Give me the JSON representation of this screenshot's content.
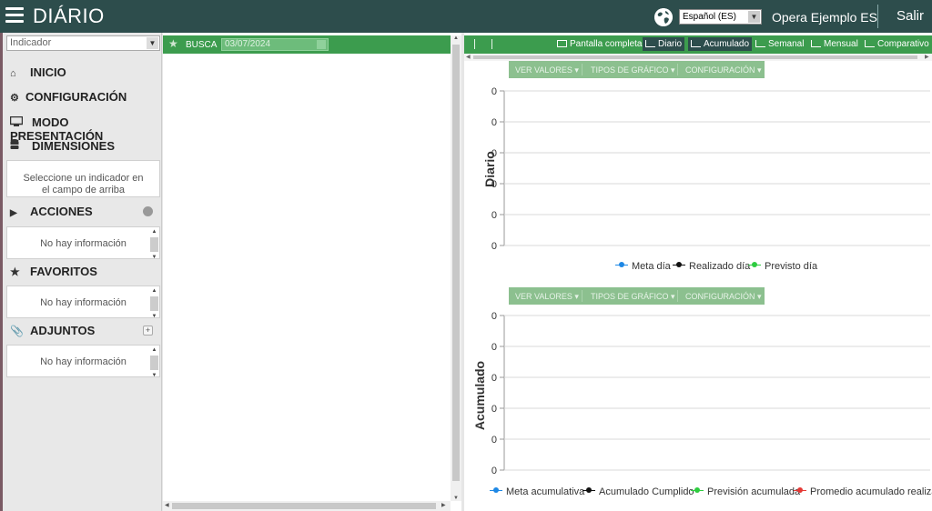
{
  "header": {
    "app_title": "DIÁRIO",
    "language": "Español (ES)",
    "user_name": "Opera Ejemplo ES",
    "logout_label": "Salir"
  },
  "sidebar": {
    "indicator_placeholder": "Indicador",
    "menu": [
      {
        "label": "INICIO",
        "icon": "home-icon"
      },
      {
        "label": "CONFIGURACIÓN",
        "icon": "gear-icon"
      },
      {
        "label": "MODO PRESENTACIÓN",
        "icon": "monitor-icon"
      },
      {
        "label": "DIMENSIONES",
        "icon": "database-icon"
      }
    ],
    "dimensions_message": "Seleccione un indicador en el campo de arriba",
    "sections": [
      {
        "label": "ACCIONES",
        "icon": "play-icon",
        "message": "No hay información"
      },
      {
        "label": "FAVORITOS",
        "icon": "star-icon",
        "message": "No hay información"
      },
      {
        "label": "ADJUNTOS",
        "icon": "paperclip-icon",
        "message": "No hay información"
      }
    ]
  },
  "middle": {
    "search_label": "BUSCA",
    "date_value": "03/07/2024"
  },
  "toolbar": {
    "buttons": [
      {
        "label": "Pantalla completa",
        "icon": "fullscreen-icon",
        "active": false
      },
      {
        "label": "Diario",
        "icon": "line-chart-icon",
        "active": true
      },
      {
        "label": "Acumulado",
        "icon": "line-chart-icon",
        "active": true
      },
      {
        "label": "Semanal",
        "icon": "line-chart-icon",
        "active": false
      },
      {
        "label": "Mensual",
        "icon": "bar-chart-icon",
        "active": false
      },
      {
        "label": "Comparativo",
        "icon": "bar-chart-icon",
        "active": false
      }
    ]
  },
  "chart_menu": {
    "items": [
      "VER VALORES",
      "TIPOS DE GRÁFICO",
      "CONFIGURACIÓN"
    ]
  },
  "colors": {
    "header_bg": "#2d4d4c",
    "green_bar": "#3c9c4e",
    "chart_menu_bg": "#8cc08f",
    "series_blue": "#1e88e5",
    "series_black": "#111111",
    "series_green": "#2ecc40",
    "series_red": "#e53935"
  },
  "chart_data": [
    {
      "type": "line",
      "ylabel": "Diario",
      "y_ticks": [
        "0",
        "0",
        "0",
        "0",
        "0",
        "0"
      ],
      "grid": true,
      "legend_position": "bottom",
      "series": [
        {
          "name": "Meta día",
          "color": "#1e88e5",
          "values": []
        },
        {
          "name": "Realizado día",
          "color": "#111111",
          "values": []
        },
        {
          "name": "Previsto día",
          "color": "#2ecc40",
          "values": []
        }
      ]
    },
    {
      "type": "line",
      "ylabel": "Acumulado",
      "y_ticks": [
        "0",
        "0",
        "0",
        "0",
        "0",
        "0"
      ],
      "grid": true,
      "legend_position": "bottom",
      "series": [
        {
          "name": "Meta acumulativa",
          "color": "#1e88e5",
          "values": []
        },
        {
          "name": "Acumulado Cumplido",
          "color": "#111111",
          "values": []
        },
        {
          "name": "Previsión acumulada",
          "color": "#2ecc40",
          "values": []
        },
        {
          "name": "Promedio acumulado realizado",
          "color": "#e53935",
          "values": []
        }
      ]
    }
  ]
}
